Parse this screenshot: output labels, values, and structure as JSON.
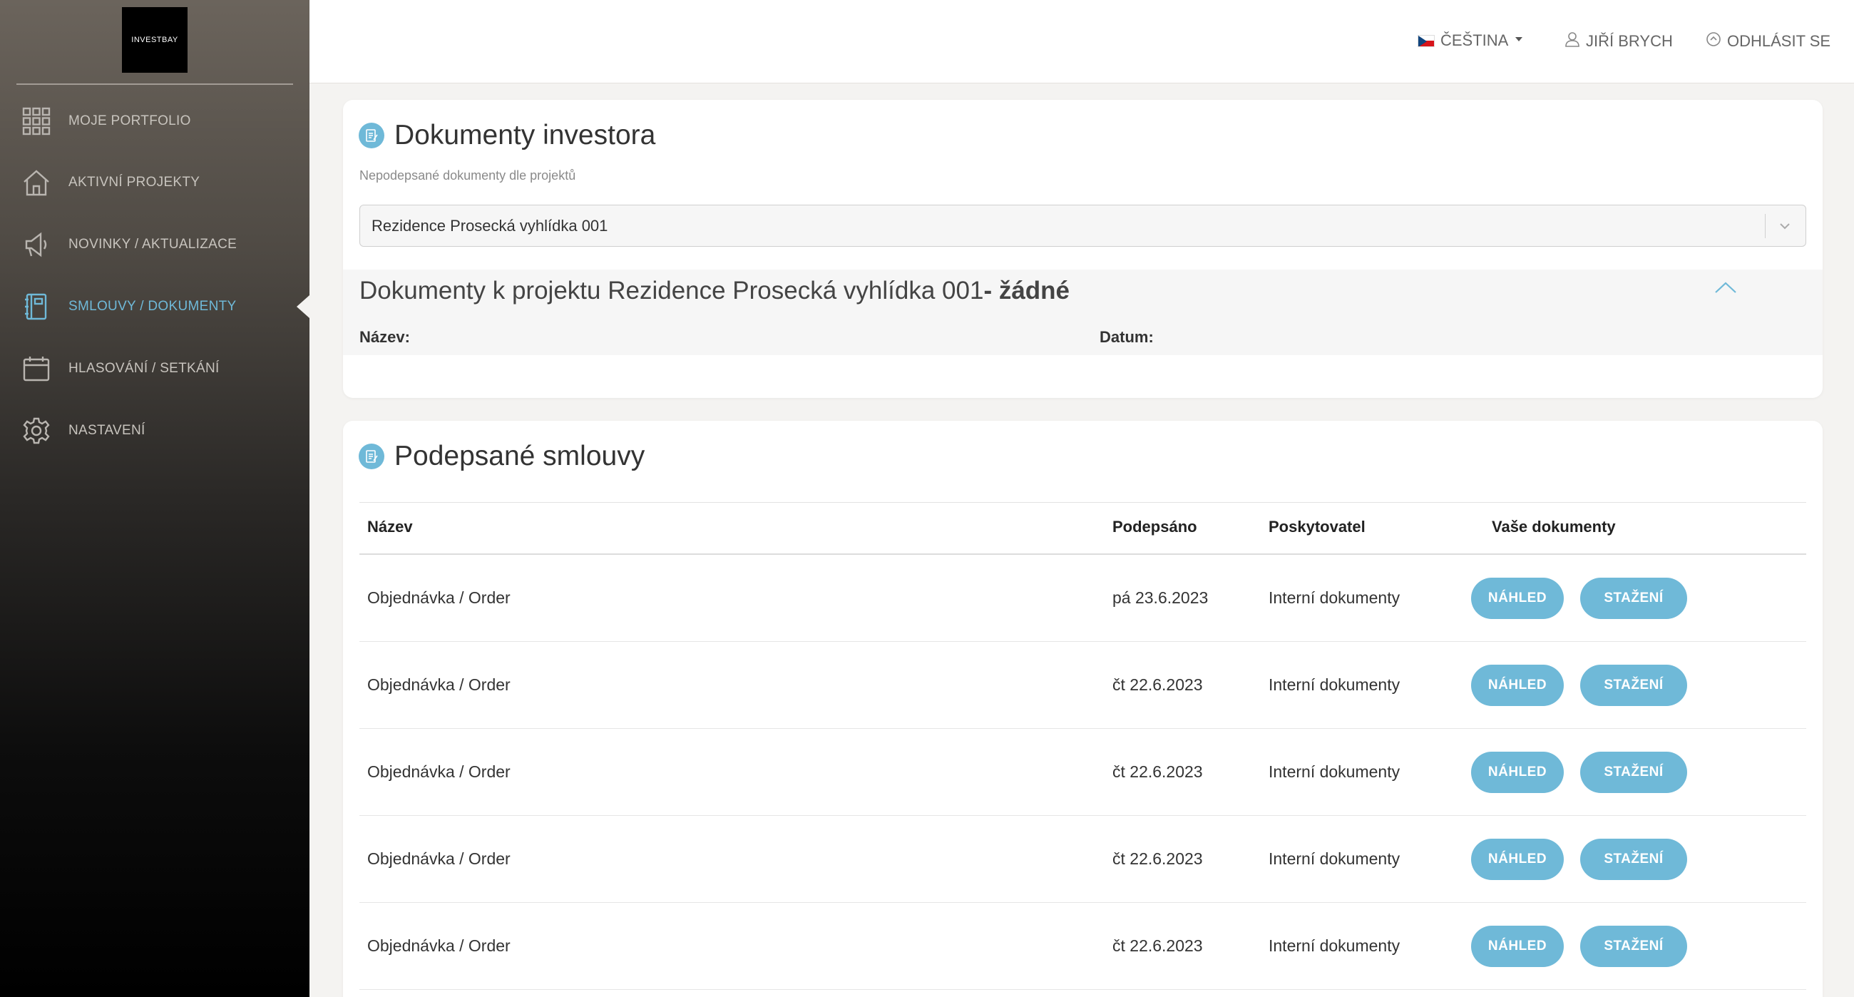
{
  "brand": {
    "logo_text": "INVESTBAY"
  },
  "sidebar": {
    "items": [
      {
        "label": "MOJE PORTFOLIO",
        "icon": "grid-icon"
      },
      {
        "label": "AKTIVNÍ PROJEKTY",
        "icon": "home-icon"
      },
      {
        "label": "NOVINKY / AKTUALIZACE",
        "icon": "megaphone-icon"
      },
      {
        "label": "SMLOUVY / DOKUMENTY",
        "icon": "notebook-icon",
        "active": true
      },
      {
        "label": "HLASOVÁNÍ / SETKÁNÍ",
        "icon": "calendar-icon"
      },
      {
        "label": "NASTAVENÍ",
        "icon": "gear-icon"
      }
    ]
  },
  "header": {
    "language": "ČEŠTINA",
    "user": "JIŘÍ BRYCH",
    "logout": "ODHLÁSIT SE"
  },
  "investor_docs": {
    "title": "Dokumenty investora",
    "subtitle": "Nepodepsané dokumenty dle projektů",
    "selected_project": "Rezidence Prosecká vyhlídka 001",
    "project_heading": "Dokumenty k projektu Rezidence Prosecká vyhlídka 001",
    "project_status": "- žádné",
    "col_name": "Název:",
    "col_date": "Datum:"
  },
  "signed": {
    "title": "Podepsané smlouvy",
    "columns": [
      "Název",
      "Podepsáno",
      "Poskytovatel",
      "Vaše dokumenty"
    ],
    "btn_preview": "NÁHLED",
    "btn_download": "STAŽENÍ",
    "rows": [
      {
        "name": "Objednávka / Order",
        "signed": "pá 23.6.2023",
        "provider": "Interní dokumenty"
      },
      {
        "name": "Objednávka / Order",
        "signed": "čt 22.6.2023",
        "provider": "Interní dokumenty"
      },
      {
        "name": "Objednávka / Order",
        "signed": "čt 22.6.2023",
        "provider": "Interní dokumenty"
      },
      {
        "name": "Objednávka / Order",
        "signed": "čt 22.6.2023",
        "provider": "Interní dokumenty"
      },
      {
        "name": "Objednávka / Order",
        "signed": "čt 22.6.2023",
        "provider": "Interní dokumenty"
      }
    ]
  },
  "colors": {
    "accent": "#6fb9d8",
    "background": "#f4f3f1",
    "sidebar_top": "#6b645c",
    "sidebar_bottom": "#000000"
  }
}
